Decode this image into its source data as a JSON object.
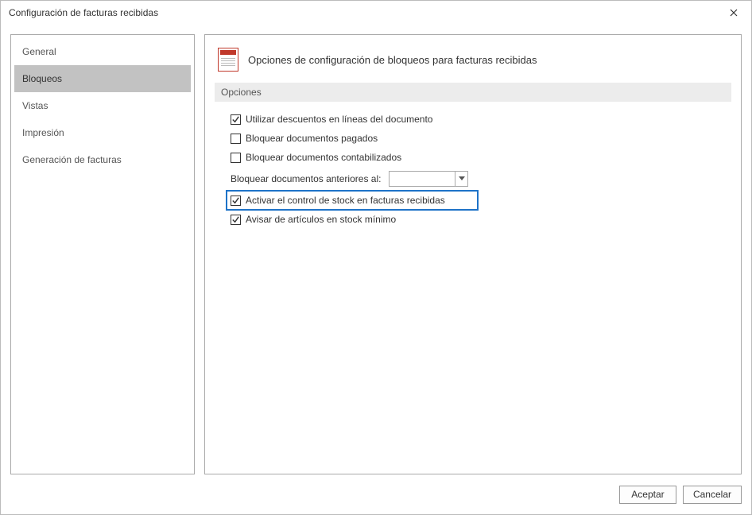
{
  "window": {
    "title": "Configuración de facturas recibidas"
  },
  "sidebar": {
    "items": [
      {
        "label": "General",
        "selected": false
      },
      {
        "label": "Bloqueos",
        "selected": true
      },
      {
        "label": "Vistas",
        "selected": false
      },
      {
        "label": "Impresión",
        "selected": false
      },
      {
        "label": "Generación de facturas",
        "selected": false
      }
    ]
  },
  "panel": {
    "title": "Opciones de configuración de bloqueos para facturas recibidas",
    "section": "Opciones",
    "options": {
      "use_discounts": {
        "label": "Utilizar descuentos en líneas del documento",
        "checked": true
      },
      "lock_paid": {
        "label": "Bloquear documentos pagados",
        "checked": false
      },
      "lock_posted": {
        "label": "Bloquear documentos contabilizados",
        "checked": false
      },
      "lock_before": {
        "label": "Bloquear documentos anteriores al:",
        "date": ""
      },
      "stock_control": {
        "label": "Activar el control de stock en facturas recibidas",
        "checked": true,
        "highlighted": true
      },
      "min_stock_warn": {
        "label": "Avisar de artículos en stock mínimo",
        "checked": true
      }
    }
  },
  "footer": {
    "accept": "Aceptar",
    "cancel": "Cancelar"
  }
}
